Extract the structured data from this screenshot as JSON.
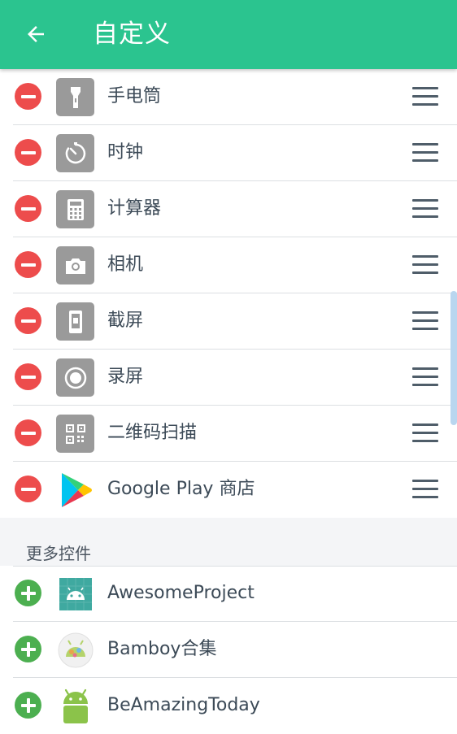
{
  "appbar": {
    "title": "自定义",
    "back_icon": "arrow-left-icon"
  },
  "active_items": [
    {
      "label": "手电筒",
      "icon": "flashlight-icon"
    },
    {
      "label": "时钟",
      "icon": "timer-icon"
    },
    {
      "label": "计算器",
      "icon": "calculator-icon"
    },
    {
      "label": "相机",
      "icon": "camera-icon"
    },
    {
      "label": "截屏",
      "icon": "screenshot-icon"
    },
    {
      "label": "录屏",
      "icon": "screen-record-icon"
    },
    {
      "label": "二维码扫描",
      "icon": "qr-scan-icon"
    },
    {
      "label": "Google Play 商店",
      "icon": "google-play-icon"
    }
  ],
  "more_section": {
    "title": "更多控件",
    "items": [
      {
        "label": "AwesomeProject",
        "icon": "android-app-icon"
      },
      {
        "label": "Bamboy合集",
        "icon": "bamboy-app-icon"
      },
      {
        "label": "BeAmazingToday",
        "icon": "android-robot-icon"
      }
    ]
  },
  "colors": {
    "appbar": "#2bc48f",
    "remove": "#ed4c4c",
    "add": "#4caf50",
    "tile": "#9a9a9a"
  }
}
